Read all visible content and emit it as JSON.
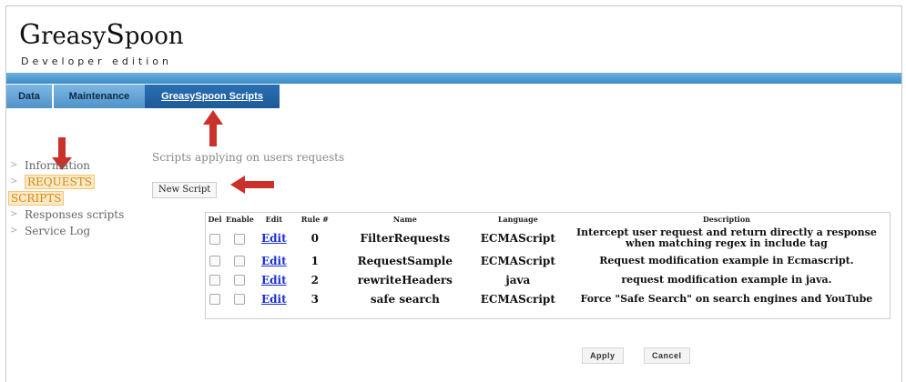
{
  "app": {
    "logo_g": "G",
    "logo_rest1": "reasy",
    "logo_s": "S",
    "logo_rest2": "poon",
    "edition": "Developer edition"
  },
  "tabs": [
    {
      "label": "Data"
    },
    {
      "label": "Maintenance"
    },
    {
      "label": "GreasySpoon Scripts"
    }
  ],
  "nav": {
    "items": [
      {
        "label": "Information"
      },
      {
        "label": "REQUESTS"
      },
      {
        "label": "SCRIPTS"
      },
      {
        "label": "Responses scripts"
      },
      {
        "label": "Service Log"
      }
    ]
  },
  "main": {
    "section_title": "Scripts applying on users requests",
    "new_script_label": "New Script",
    "columns": [
      "Del",
      "Enable",
      "Edit",
      "Rule #",
      "Name",
      "Language",
      "Description"
    ],
    "rows": [
      {
        "edit": "Edit",
        "rule": "0",
        "name": "FilterRequests",
        "language": "ECMAScript",
        "description": "Intercept user request and return directly a response when matching regex in include tag"
      },
      {
        "edit": "Edit",
        "rule": "1",
        "name": "RequestSample",
        "language": "ECMAScript",
        "description": "Request modification example in Ecmascript."
      },
      {
        "edit": "Edit",
        "rule": "2",
        "name": "rewriteHeaders",
        "language": "java",
        "description": "request modification example in java."
      },
      {
        "edit": "Edit",
        "rule": "3",
        "name": "safe search",
        "language": "ECMAScript",
        "description": "Force \"Safe Search\" on search engines and YouTube"
      }
    ]
  },
  "footer": {
    "apply_label": "Apply",
    "cancel_label": "Cancel"
  },
  "colors": {
    "band": "#3b8bc6",
    "active_tab": "#1d5a99",
    "arrow": "#c9312a",
    "nav_selected": "#d08a1a"
  }
}
